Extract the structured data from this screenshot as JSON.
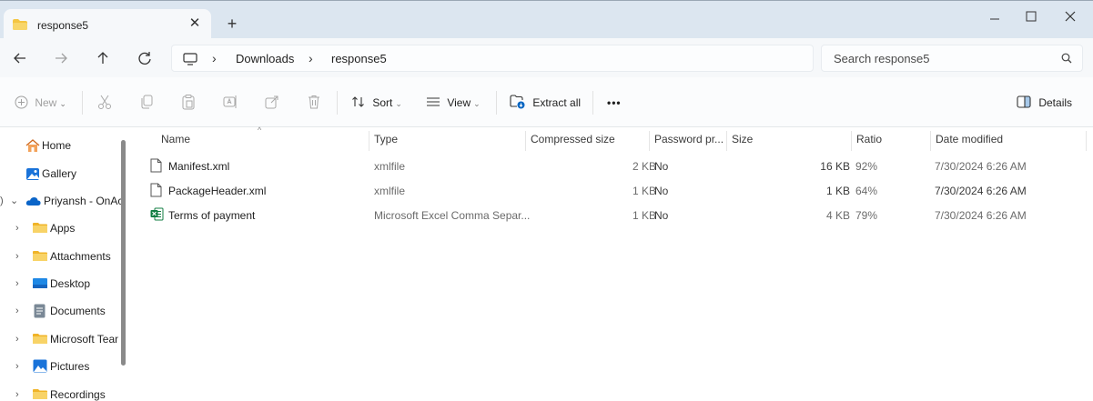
{
  "tab": {
    "title": "response5",
    "close": "✕",
    "new": "+"
  },
  "window": {
    "minimize": "–",
    "maximize": "☐",
    "close": "✕"
  },
  "address": {
    "breadcrumbs": [
      "Downloads",
      "response5"
    ],
    "separator": "›",
    "search_placeholder": "Search response5"
  },
  "toolbar": {
    "new": "New",
    "sort": "Sort",
    "view": "View",
    "extract_all": "Extract all",
    "more": "•••",
    "details": "Details"
  },
  "sidebar": {
    "items": [
      {
        "label": "Home",
        "icon": "home-icon",
        "expandable": false
      },
      {
        "label": "Gallery",
        "icon": "gallery-icon",
        "expandable": false
      },
      {
        "label": "Priyansh - OnAc",
        "icon": "onedrive-icon",
        "expandable": true,
        "expanded": true
      },
      {
        "label": "Apps",
        "icon": "folder-icon",
        "expandable": true
      },
      {
        "label": "Attachments",
        "icon": "folder-icon",
        "expandable": true
      },
      {
        "label": "Desktop",
        "icon": "desktop-icon",
        "expandable": true
      },
      {
        "label": "Documents",
        "icon": "documents-icon",
        "expandable": true
      },
      {
        "label": "Microsoft Tean",
        "icon": "folder-icon",
        "expandable": true
      },
      {
        "label": "Pictures",
        "icon": "pictures-icon",
        "expandable": true
      },
      {
        "label": "Recordings",
        "icon": "folder-icon",
        "expandable": true
      }
    ]
  },
  "columns": {
    "name": "Name",
    "type": "Type",
    "compressed_size": "Compressed size",
    "password": "Password pr...",
    "size": "Size",
    "ratio": "Ratio",
    "date_modified": "Date modified"
  },
  "files": [
    {
      "name": "Manifest.xml",
      "type": "xmlfile",
      "compressed": "2 KB",
      "password": "No",
      "size": "16 KB",
      "ratio": "92%",
      "date": "7/30/2024 6:26 AM",
      "icon": "document-icon"
    },
    {
      "name": "PackageHeader.xml",
      "type": "xmlfile",
      "compressed": "1 KB",
      "password": "No",
      "size": "1 KB",
      "ratio": "64%",
      "date": "7/30/2024 6:26 AM",
      "icon": "document-icon"
    },
    {
      "name": "Terms of payment",
      "type": "Microsoft Excel Comma Separ...",
      "compressed": "1 KB",
      "password": "No",
      "size": "4 KB",
      "ratio": "79%",
      "date": "7/30/2024 6:26 AM",
      "icon": "excel-csv-icon"
    }
  ],
  "colors": {
    "titlebar": "#dce6f0",
    "accent": "#0a66c2",
    "folder": "#f4c542",
    "excel": "#107c41"
  }
}
